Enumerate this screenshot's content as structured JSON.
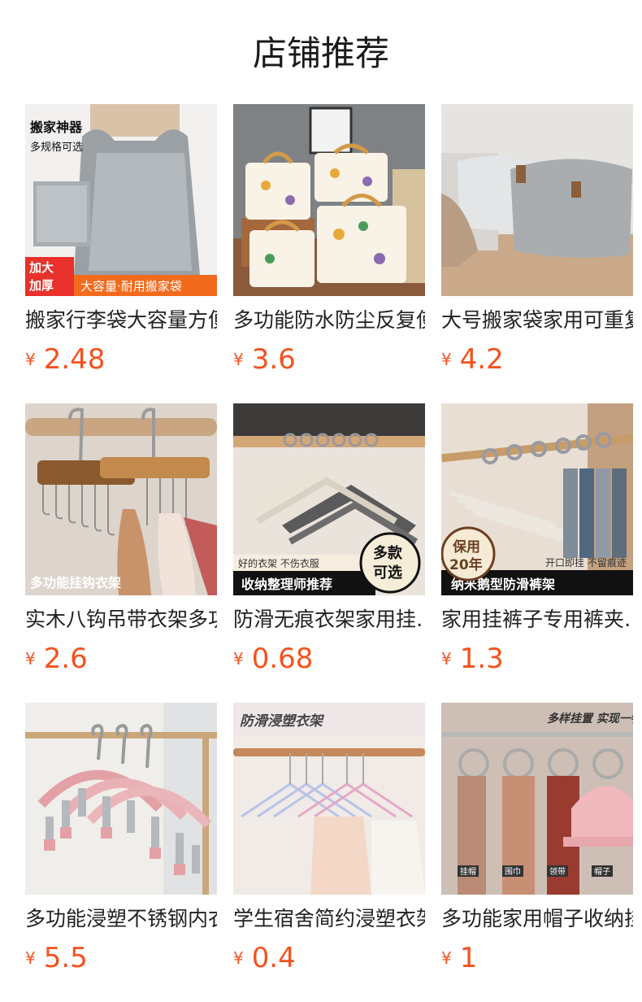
{
  "page": {
    "title": "店铺推荐"
  },
  "products": [
    {
      "name": "搬家行李袋大容量方便…",
      "currency": "¥",
      "price": "2.48",
      "image": {
        "description": "gray moving bags",
        "badge1": "搬家神器",
        "badge2": "多规格可选",
        "banner_left": "加大加厚",
        "banner_right": "大容量·耐用搬家袋"
      }
    },
    {
      "name": "多功能防水防尘反复使用…",
      "currency": "¥",
      "price": "3.6",
      "image": {
        "description": "pineapple print storage bags"
      }
    },
    {
      "name": "大号搬家袋家用可重复…",
      "currency": "¥",
      "price": "4.2",
      "image": {
        "description": "gray storage bag in living room"
      }
    },
    {
      "name": "实木八钩吊带衣架多功…",
      "currency": "¥",
      "price": "2.6",
      "image": {
        "description": "wooden eight hook hanger",
        "caption": "多功能挂钩衣架"
      }
    },
    {
      "name": "防滑无痕衣架家用挂…",
      "currency": "¥",
      "price": "0.68",
      "image": {
        "description": "non-slip hangers",
        "tag_top": "好的衣架 不伤衣服",
        "caption": "收纳整理师推荐",
        "badge": "多款可选"
      }
    },
    {
      "name": "家用挂裤子专用裤夹…",
      "currency": "¥",
      "price": "1.3",
      "image": {
        "description": "pants hangers",
        "badge": "保用20年",
        "tag_top": "开口即挂 不留痕迹",
        "caption": "纳米鹅型防滑裤架"
      }
    },
    {
      "name": "多功能浸塑不锈钢内衣…",
      "currency": "¥",
      "price": "5.5",
      "image": {
        "description": "pink clip hangers"
      }
    },
    {
      "name": "学生宿舍简约浸塑衣架…",
      "currency": "¥",
      "price": "0.4",
      "image": {
        "description": "dip plastic hangers",
        "caption": "防滑浸塑衣架"
      }
    },
    {
      "name": "多功能家用帽子收纳挂…",
      "currency": "¥",
      "price": "1",
      "image": {
        "description": "hat and scarf hanger rings",
        "caption": "多样挂置 实现一物多用",
        "labels": [
          "挂帽",
          "围巾",
          "领带",
          "帽子"
        ]
      }
    }
  ]
}
